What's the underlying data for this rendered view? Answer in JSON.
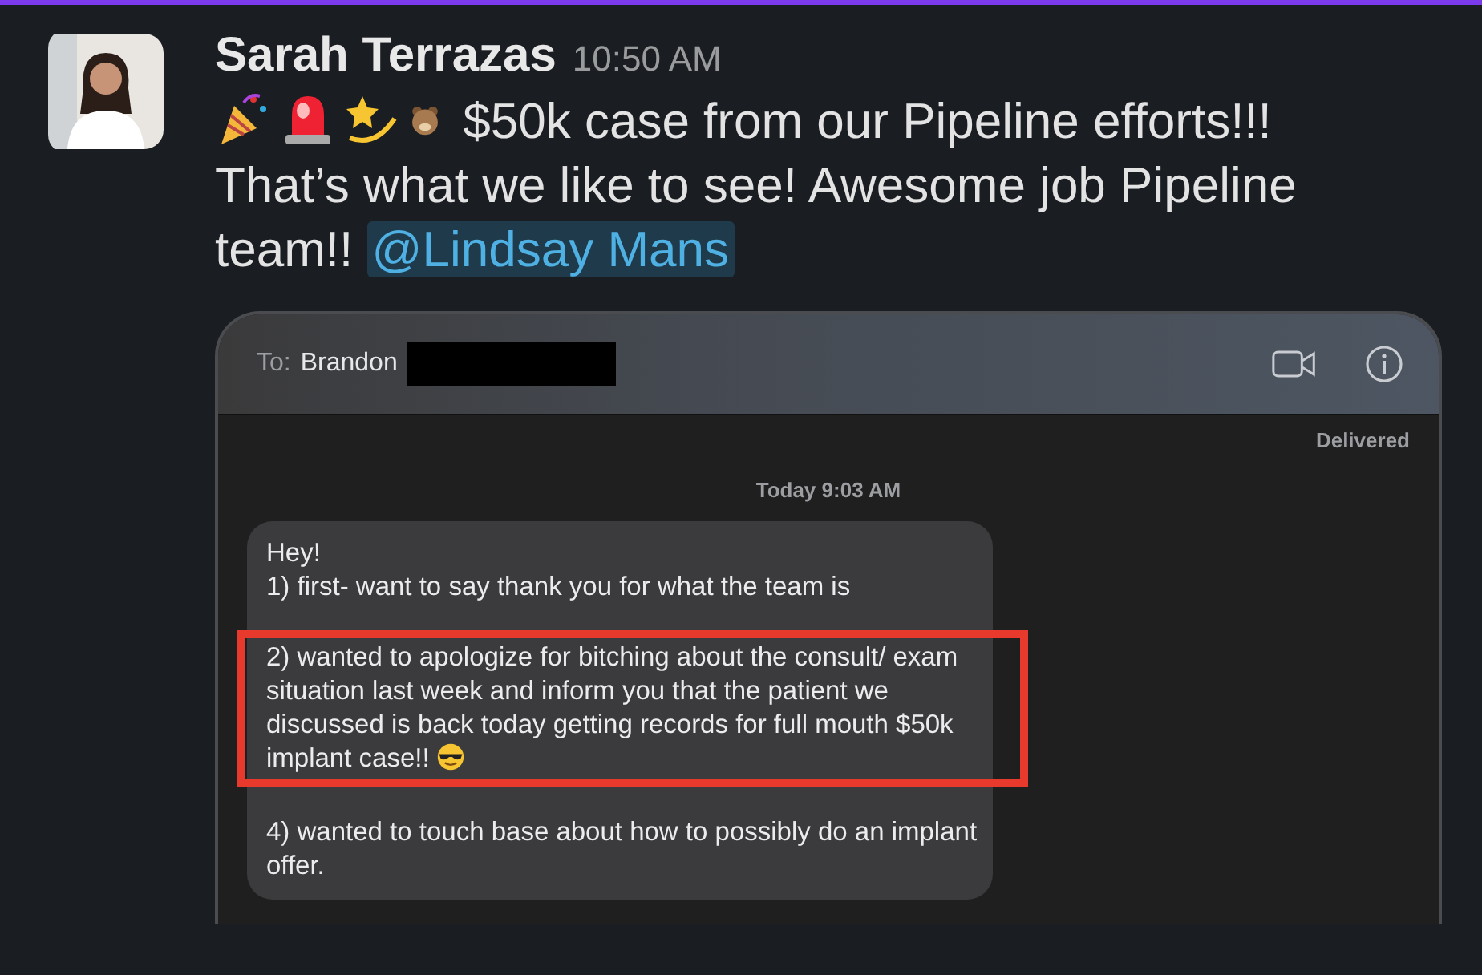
{
  "message": {
    "author": "Sarah Terrazas",
    "time": "10:50 AM",
    "text": "$50k case from our Pipeline efforts!!! That’s what we like to see! Awesome job Pipeline team!!",
    "mention": "@Lindsay Mans"
  },
  "screenshot": {
    "to_label": "To:",
    "recipient": "Brandon",
    "status": "Delivered",
    "timestamp": "Today 9:03 AM",
    "paragraphs": [
      {
        "kind": "plain",
        "text": "Hey!"
      },
      {
        "kind": "plain",
        "text": "1) first- want to say thank you for what the team is"
      },
      {
        "kind": "highlighted",
        "text": "2) wanted to apologize for bitching about the consult/ exam situation last week and inform you that the patient we discussed is back today getting records for full mouth $50k implant case!!"
      },
      {
        "kind": "plain",
        "text": "4) wanted to touch base about how to possibly do an implant offer."
      }
    ]
  }
}
